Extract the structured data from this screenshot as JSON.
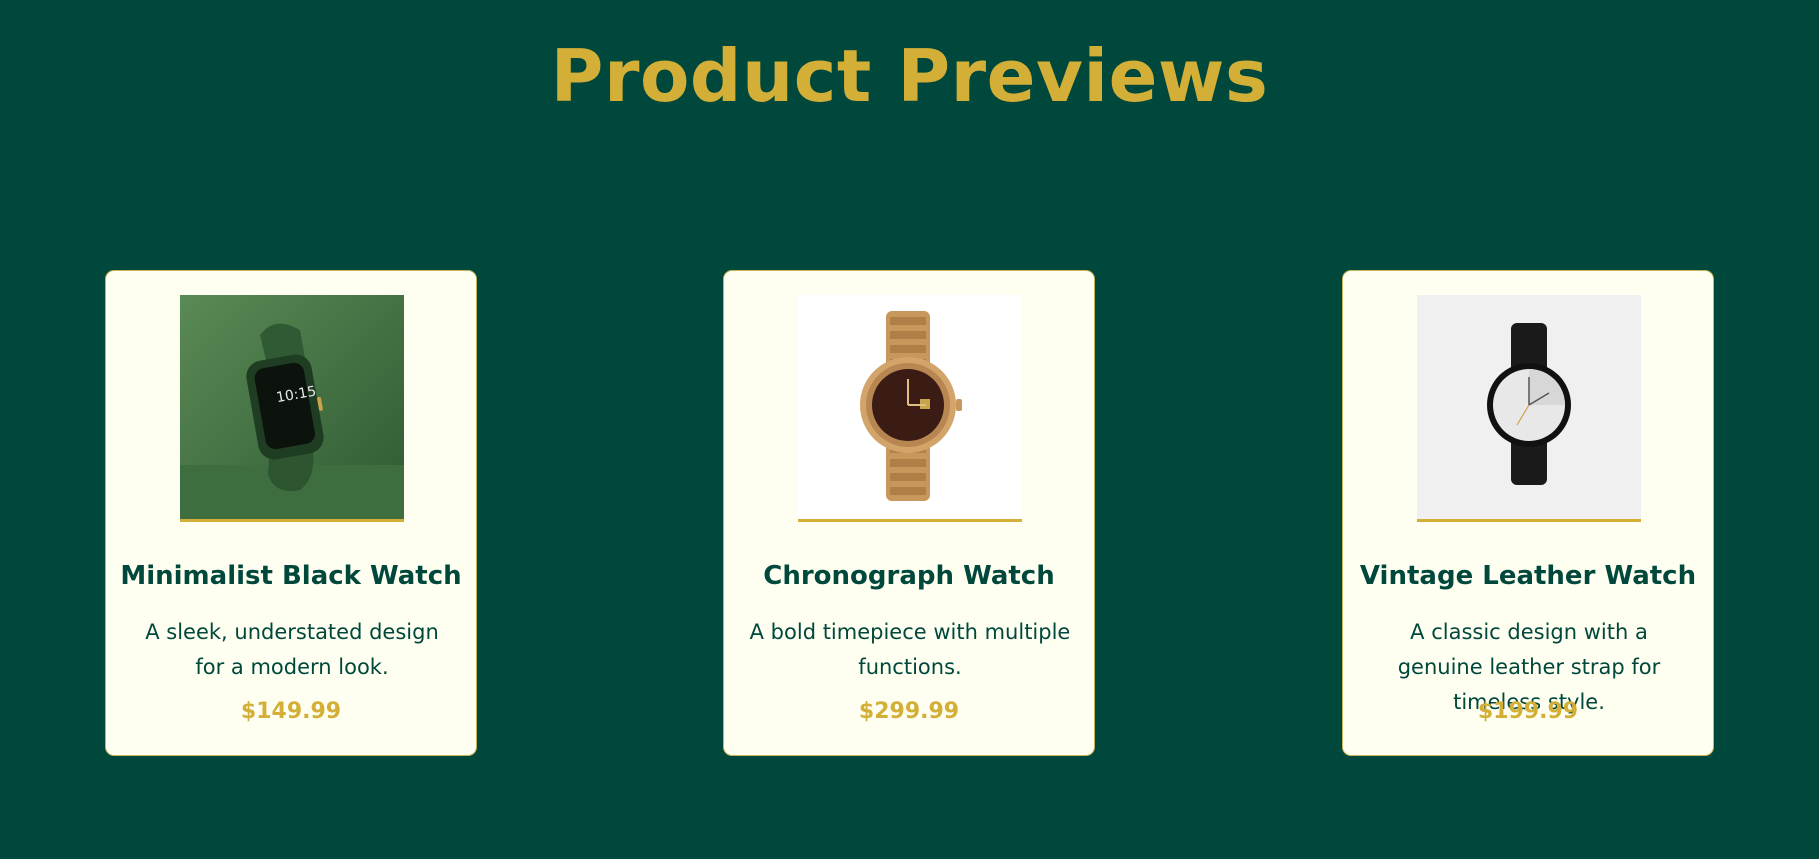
{
  "page": {
    "title": "Product Previews"
  },
  "colors": {
    "background": "#00483c",
    "accent": "#d4af37",
    "card": "#fefff0"
  },
  "products": [
    {
      "name": "Minimalist Black Watch",
      "description": "A sleek, understated design for a modern look.",
      "price": "$149.99",
      "image_icon": "smartwatch-image",
      "watch_display": "10:15"
    },
    {
      "name": "Chronograph Watch",
      "description": "A bold timepiece with multiple functions.",
      "price": "$299.99",
      "image_icon": "gold-watch-image"
    },
    {
      "name": "Vintage Leather Watch",
      "description": "A classic design with a genuine leather strap for timeless style.",
      "price": "$199.99",
      "image_icon": "leather-watch-image"
    }
  ]
}
